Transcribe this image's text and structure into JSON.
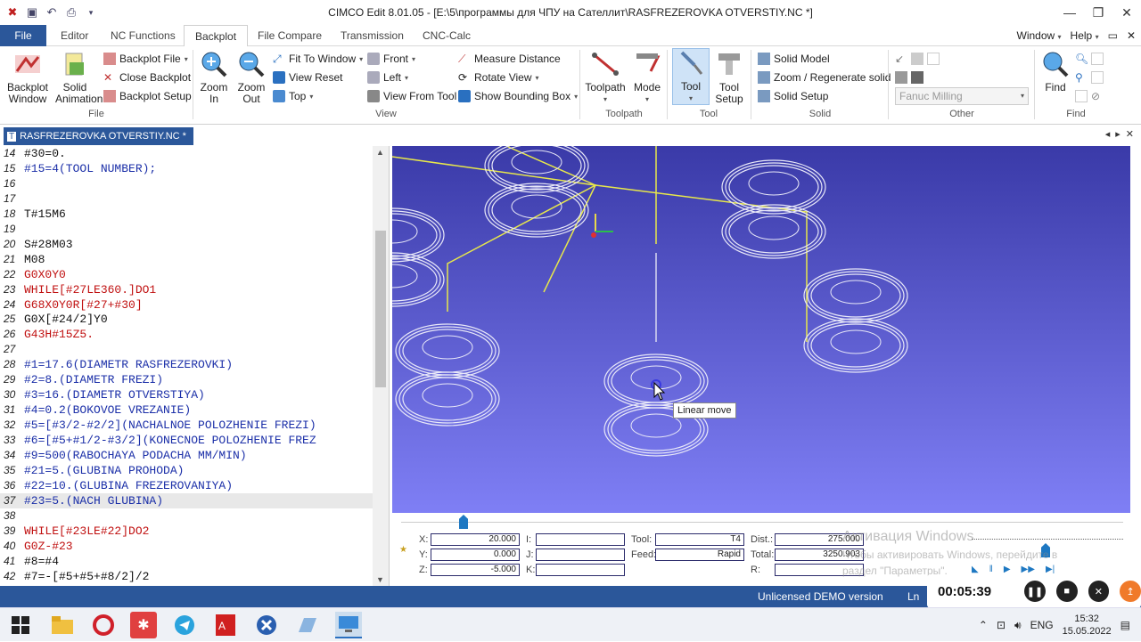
{
  "window": {
    "title": "CIMCO Edit 8.01.05 - [E:\\5\\программы для ЧПУ на Сателлит\\RASFREZEROVKA OTVERSTIY.NC *]"
  },
  "menu": {
    "file": "File",
    "tabs": [
      "Editor",
      "NC Functions",
      "Backplot",
      "File Compare",
      "Transmission",
      "CNC-Calc"
    ],
    "right": [
      "Window",
      "Help"
    ]
  },
  "ribbon": {
    "file_group": {
      "label": "File",
      "backplot_window": "Backplot Window",
      "solid_animation": "Solid Animation",
      "backplot_file": "Backplot File",
      "close_backplot": "Close Backplot",
      "backplot_setup": "Backplot Setup"
    },
    "view_group": {
      "label": "View",
      "zoom_in": "Zoom In",
      "zoom_out": "Zoom Out",
      "fit_to_window": "Fit To Window",
      "view_reset": "View Reset",
      "top": "Top",
      "front": "Front",
      "left": "Left",
      "view_from_tool": "View From Tool",
      "measure_distance": "Measure Distance",
      "rotate_view": "Rotate View",
      "show_bounding_box": "Show Bounding Box"
    },
    "toolpath_group": {
      "label": "Toolpath",
      "toolpath": "Toolpath",
      "mode": "Mode"
    },
    "tool_group": {
      "label": "Tool",
      "tool": "Tool",
      "tool_setup": "Tool Setup"
    },
    "solid_group": {
      "label": "Solid",
      "solid_model": "Solid Model",
      "zoom_regenerate": "Zoom / Regenerate solid",
      "solid_setup": "Solid Setup"
    },
    "other_group": {
      "label": "Other",
      "machine": "Fanuc Milling"
    },
    "find_group": {
      "label": "Find",
      "find": "Find"
    }
  },
  "doc_tab": {
    "name": "RASFREZEROVKA OTVERSTIY.NC *"
  },
  "editor_lines": [
    {
      "n": "14",
      "text": "#30=0.",
      "color": "black"
    },
    {
      "n": "15",
      "text": "#15=4(TOOL NUMBER);",
      "color": "blue"
    },
    {
      "n": "16",
      "text": "",
      "color": "black"
    },
    {
      "n": "17",
      "text": "",
      "color": "black"
    },
    {
      "n": "18",
      "text": "T#15M6",
      "color": "black"
    },
    {
      "n": "19",
      "text": "",
      "color": "black"
    },
    {
      "n": "20",
      "text": "S#28M03",
      "color": "black"
    },
    {
      "n": "21",
      "text": "M08",
      "color": "black"
    },
    {
      "n": "22",
      "text": "G0X0Y0",
      "color": "red"
    },
    {
      "n": "23",
      "text": "WHILE[#27LE360.]DO1",
      "color": "red"
    },
    {
      "n": "24",
      "text": "G68X0Y0R[#27+#30]",
      "color": "red"
    },
    {
      "n": "25",
      "text": "G0X[#24/2]Y0",
      "color": "black"
    },
    {
      "n": "26",
      "text": "G43H#15Z5.",
      "color": "red"
    },
    {
      "n": "27",
      "text": "",
      "color": "black"
    },
    {
      "n": "28",
      "text": "#1=17.6(DIAMETR RASFREZEROVKI)",
      "color": "blue"
    },
    {
      "n": "29",
      "text": "#2=8.(DIAMETR FREZI)",
      "color": "blue"
    },
    {
      "n": "30",
      "text": "#3=16.(DIAMETR OTVERSTIYA)",
      "color": "blue"
    },
    {
      "n": "31",
      "text": "#4=0.2(BOKOVOE VREZANIE)",
      "color": "blue"
    },
    {
      "n": "32",
      "text": "#5=[#3/2-#2/2](NACHALNOE POLOZHENIE FREZI)",
      "color": "blue"
    },
    {
      "n": "33",
      "text": "#6=[#5+#1/2-#3/2](KONECNOE POLOZHENIE FREZ",
      "color": "blue"
    },
    {
      "n": "34",
      "text": "#9=500(RABOCHAYA PODACHA MM/MIN)",
      "color": "blue"
    },
    {
      "n": "35",
      "text": "#21=5.(GLUBINA PROHODA)",
      "color": "blue"
    },
    {
      "n": "36",
      "text": "#22=10.(GLUBINA FREZEROVANIYA)",
      "color": "blue"
    },
    {
      "n": "37",
      "text": "#23=5.(NACH GLUBINA)",
      "color": "blue",
      "highlight": true
    },
    {
      "n": "38",
      "text": "",
      "color": "black"
    },
    {
      "n": "39",
      "text": "WHILE[#23LE#22]DO2",
      "color": "red"
    },
    {
      "n": "40",
      "text": "G0Z-#23",
      "color": "red"
    },
    {
      "n": "41",
      "text": "#8=#4",
      "color": "black"
    },
    {
      "n": "42",
      "text": "#7=-[#5+#5+#8/2]/2",
      "color": "black"
    }
  ],
  "viewport": {
    "background_top": "#3a3aa8",
    "background_bottom": "#7f7ff5",
    "tooltip": "Linear move"
  },
  "readout": {
    "x_label": "X:",
    "x": "20.000",
    "y_label": "Y:",
    "y": "0.000",
    "z_label": "Z:",
    "z": "-5.000",
    "i_label": "I:",
    "j_label": "J:",
    "k_label": "K:",
    "tool_label": "Tool:",
    "tool": "T4",
    "feed_label": "Feed:",
    "feed": "Rapid",
    "dist_label": "Dist.:",
    "dist": "275.000",
    "total_label": "Total:",
    "total": "3250.903",
    "r_label": "R:"
  },
  "watermark": {
    "line1": "Активация Windows",
    "line2": "Чтобы активировать Windows, перейдите в",
    "line3": "раздел \"Параметры\"."
  },
  "status": {
    "message": "Unlicensed DEMO version",
    "ln": "Ln"
  },
  "recorder": {
    "time": "00:05:39"
  },
  "tray": {
    "lang": "ENG",
    "time": "15:32",
    "date": "15.05.2022"
  }
}
